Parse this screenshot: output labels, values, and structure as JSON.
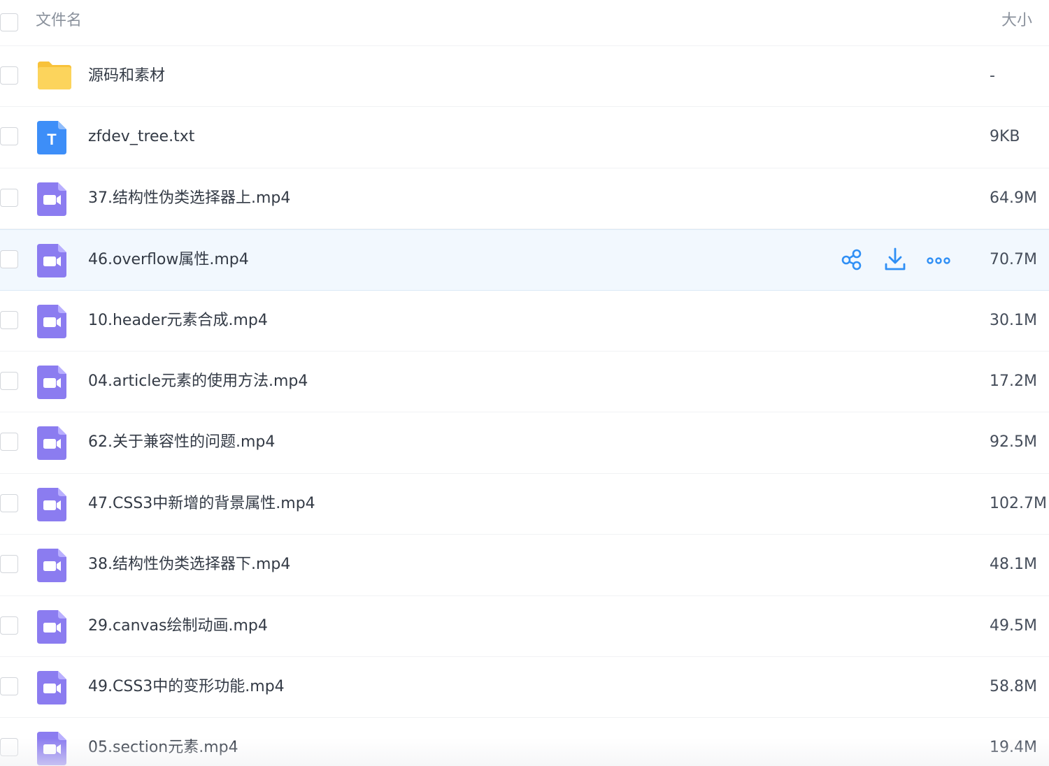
{
  "header": {
    "name_label": "文件名",
    "size_label": "大小"
  },
  "rows": [
    {
      "name": "源码和素材",
      "size": "-",
      "type": "folder-icon"
    },
    {
      "name": "zfdev_tree.txt",
      "size": "9KB",
      "type": "text-file-icon"
    },
    {
      "name": "37.结构性伪类选择器上.mp4",
      "size": "64.9M",
      "type": "video-file-icon"
    },
    {
      "name": "46.overflow属性.mp4",
      "size": "70.7M",
      "type": "video-file-icon",
      "hovered": true
    },
    {
      "name": "10.header元素合成.mp4",
      "size": "30.1M",
      "type": "video-file-icon"
    },
    {
      "name": "04.article元素的使用方法.mp4",
      "size": "17.2M",
      "type": "video-file-icon"
    },
    {
      "name": "62.关于兼容性的问题.mp4",
      "size": "92.5M",
      "type": "video-file-icon"
    },
    {
      "name": "47.CSS3中新增的背景属性.mp4",
      "size": "102.7M",
      "type": "video-file-icon"
    },
    {
      "name": "38.结构性伪类选择器下.mp4",
      "size": "48.1M",
      "type": "video-file-icon"
    },
    {
      "name": "29.canvas绘制动画.mp4",
      "size": "49.5M",
      "type": "video-file-icon"
    },
    {
      "name": "49.CSS3中的变形功能.mp4",
      "size": "58.8M",
      "type": "video-file-icon"
    },
    {
      "name": "05.section元素.mp4",
      "size": "19.4M",
      "type": "video-file-icon"
    }
  ],
  "row_actions": [
    "share-icon",
    "download-icon",
    "more-icon"
  ],
  "colors": {
    "folder": "#fcd45c",
    "text_file": "#3d8ef8",
    "video_file": "#8b7cf0",
    "action_blue": "#2f8ff5",
    "hover_bg": "#f2f8fe"
  }
}
